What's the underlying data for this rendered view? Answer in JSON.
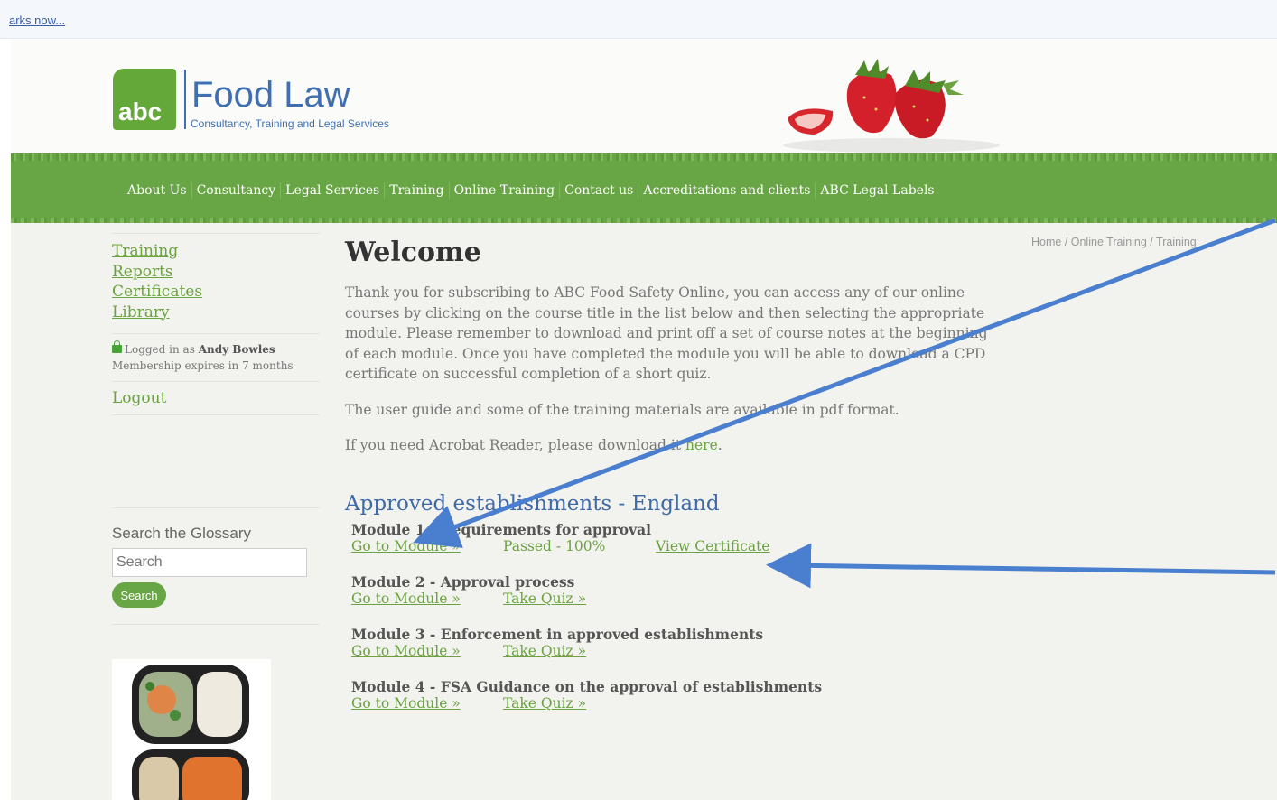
{
  "browser": {
    "bookmarks_link": "arks now..."
  },
  "logo": {
    "abc": "abc",
    "title": "Food Law",
    "subtitle": "Consultancy, Training and Legal Services"
  },
  "nav": [
    "About Us",
    "Consultancy",
    "Legal Services",
    "Training",
    "Online Training",
    "Contact us",
    "Accreditations and clients",
    "ABC Legal Labels"
  ],
  "breadcrumb": "Home / Online Training / Training",
  "sidebar": {
    "links": [
      "Training",
      "Reports",
      "Certificates",
      "Library"
    ],
    "logged_prefix": "Logged in as",
    "user": "Andy Bowles",
    "membership": "Membership expires in 7 months",
    "logout": "Logout",
    "glossary_title": "Search the Glossary",
    "glossary_placeholder": "Search",
    "glossary_button": "Search"
  },
  "main": {
    "title": "Welcome",
    "intro": "Thank you for subscribing to ABC Food Safety Online, you can access any of our online courses by clicking on the course title in the list below and then selecting the appropriate module. Please remember to download and print off a set of course notes at the beginning of each module. Once you have completed the module you will be able to download a CPD certificate on successful completion of a short quiz.",
    "pdf_note": "The user guide and some of the training materials are available in pdf format.",
    "acrobat_prefix": "If you need Acrobat Reader, please download it",
    "acrobat_link": "here",
    "course_title": "Approved establishments - England",
    "modules": [
      {
        "title": "Module 1 - Requirements for approval",
        "go": "Go to Module »",
        "status": "Passed - 100%",
        "action": "View Certificate"
      },
      {
        "title": "Module 2 - Approval process",
        "go": "Go to Module »",
        "action": "Take Quiz »"
      },
      {
        "title": "Module 3 - Enforcement in approved establishments",
        "go": "Go to Module »",
        "action": "Take Quiz »"
      },
      {
        "title": "Module 4 - FSA Guidance on the approval of establishments",
        "go": "Go to Module »",
        "action": "Take Quiz »"
      }
    ]
  },
  "colors": {
    "brand_green": "#68a545",
    "brand_blue": "#3f6fb1",
    "annotation_arrow": "#4a7fcf"
  }
}
